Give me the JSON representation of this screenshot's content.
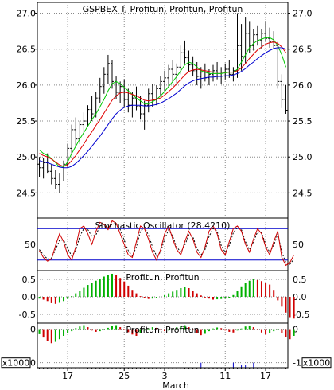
{
  "chart_data": [
    {
      "type": "candlestick",
      "title": "GSPBEX_I, Profitun, Profitun, Profitun",
      "y_ticks": [
        "27.0",
        "26.5",
        "26.0",
        "25.5",
        "25.0",
        "24.5"
      ],
      "ylim": [
        24.15,
        27.15
      ],
      "ohlc": [
        [
          24.9,
          25.0,
          24.72,
          24.85
        ],
        [
          24.85,
          24.98,
          24.7,
          24.92
        ],
        [
          24.92,
          25.05,
          24.78,
          24.8
        ],
        [
          24.8,
          24.9,
          24.62,
          24.7
        ],
        [
          24.7,
          24.82,
          24.55,
          24.62
        ],
        [
          24.62,
          24.78,
          24.5,
          24.72
        ],
        [
          24.72,
          24.95,
          24.66,
          24.9
        ],
        [
          24.9,
          25.18,
          24.85,
          25.12
        ],
        [
          25.12,
          25.45,
          25.05,
          25.38
        ],
        [
          25.38,
          25.55,
          25.15,
          25.25
        ],
        [
          25.25,
          25.5,
          25.18,
          25.45
        ],
        [
          25.45,
          25.62,
          25.3,
          25.5
        ],
        [
          25.5,
          25.72,
          25.42,
          25.66
        ],
        [
          25.66,
          25.85,
          25.5,
          25.6
        ],
        [
          25.6,
          25.9,
          25.55,
          25.82
        ],
        [
          25.82,
          26.1,
          25.75,
          25.98
        ],
        [
          25.98,
          26.25,
          25.88,
          26.15
        ],
        [
          26.15,
          26.42,
          26.02,
          26.3
        ],
        [
          26.3,
          26.35,
          25.95,
          26.05
        ],
        [
          26.05,
          26.12,
          25.8,
          25.9
        ],
        [
          25.9,
          26.05,
          25.75,
          25.98
        ],
        [
          25.98,
          26.08,
          25.7,
          25.8
        ],
        [
          25.8,
          25.95,
          25.62,
          25.72
        ],
        [
          25.72,
          25.9,
          25.55,
          25.82
        ],
        [
          25.82,
          25.98,
          25.65,
          25.7
        ],
        [
          25.7,
          25.85,
          25.52,
          25.6
        ],
        [
          25.6,
          25.78,
          25.38,
          25.72
        ],
        [
          25.72,
          25.95,
          25.62,
          25.88
        ],
        [
          25.88,
          26.02,
          25.7,
          25.8
        ],
        [
          25.8,
          26.0,
          25.72,
          25.95
        ],
        [
          25.95,
          26.12,
          25.85,
          26.05
        ],
        [
          26.05,
          26.2,
          25.92,
          26.1
        ],
        [
          26.1,
          26.28,
          25.98,
          26.22
        ],
        [
          26.22,
          26.35,
          26.05,
          26.15
        ],
        [
          26.15,
          26.3,
          26.02,
          26.25
        ],
        [
          26.25,
          26.55,
          26.15,
          26.45
        ],
        [
          26.45,
          26.62,
          26.3,
          26.38
        ],
        [
          26.38,
          26.48,
          26.18,
          26.28
        ],
        [
          26.28,
          26.4,
          26.12,
          26.2
        ],
        [
          26.2,
          26.32,
          26.0,
          26.12
        ],
        [
          26.12,
          26.25,
          25.95,
          26.18
        ],
        [
          26.18,
          26.3,
          26.05,
          26.1
        ],
        [
          26.1,
          26.22,
          26.0,
          26.15
        ],
        [
          26.15,
          26.28,
          26.05,
          26.2
        ],
        [
          26.2,
          26.32,
          26.08,
          26.12
        ],
        [
          26.12,
          26.25,
          26.02,
          26.18
        ],
        [
          26.18,
          26.3,
          26.08,
          26.22
        ],
        [
          26.22,
          26.35,
          26.1,
          26.15
        ],
        [
          26.15,
          26.25,
          26.05,
          26.2
        ],
        [
          26.2,
          27.0,
          26.1,
          26.55
        ],
        [
          26.55,
          26.85,
          26.2,
          26.4
        ],
        [
          26.4,
          26.95,
          26.3,
          26.72
        ],
        [
          26.72,
          26.88,
          26.45,
          26.55
        ],
        [
          26.55,
          26.78,
          26.48,
          26.7
        ],
        [
          26.7,
          26.82,
          26.55,
          26.62
        ],
        [
          26.62,
          26.78,
          26.5,
          26.72
        ],
        [
          26.72,
          26.88,
          26.6,
          26.65
        ],
        [
          26.65,
          26.8,
          26.52,
          26.6
        ],
        [
          26.6,
          26.75,
          26.5,
          26.55
        ],
        [
          26.55,
          26.6,
          25.95,
          26.05
        ],
        [
          26.05,
          26.15,
          25.68,
          25.8
        ],
        [
          25.8,
          26.0,
          25.6,
          25.65
        ]
      ],
      "moving_averages": [
        {
          "color": "#00c800",
          "values": [
            25.1,
            25.05,
            25.02,
            24.98,
            24.92,
            24.86,
            24.86,
            24.93,
            25.05,
            25.15,
            25.25,
            25.34,
            25.43,
            25.52,
            25.6,
            25.7,
            25.8,
            25.92,
            26.02,
            26.05,
            26.02,
            25.97,
            25.92,
            25.87,
            25.82,
            25.78,
            25.74,
            25.74,
            25.77,
            25.8,
            25.85,
            25.91,
            25.98,
            26.05,
            26.12,
            26.2,
            26.28,
            26.32,
            26.3,
            26.25,
            26.2,
            26.18,
            26.16,
            26.16,
            26.16,
            26.16,
            26.17,
            26.18,
            26.18,
            26.22,
            26.32,
            26.42,
            26.52,
            26.58,
            26.62,
            26.64,
            26.66,
            26.66,
            26.63,
            26.55,
            26.42,
            26.25
          ]
        },
        {
          "color": "#e00000",
          "values": [
            25.05,
            25.02,
            25.0,
            24.97,
            24.93,
            24.89,
            24.87,
            24.89,
            24.95,
            25.02,
            25.1,
            25.18,
            25.27,
            25.35,
            25.44,
            25.52,
            25.61,
            25.7,
            25.79,
            25.85,
            25.89,
            25.9,
            25.89,
            25.87,
            25.85,
            25.82,
            25.79,
            25.78,
            25.79,
            25.8,
            25.82,
            25.86,
            25.91,
            25.96,
            26.02,
            26.08,
            26.14,
            26.19,
            26.21,
            26.22,
            26.21,
            26.2,
            26.19,
            26.18,
            26.18,
            26.18,
            26.18,
            26.18,
            26.18,
            26.2,
            26.24,
            26.3,
            26.37,
            26.43,
            26.49,
            26.53,
            26.57,
            26.59,
            26.6,
            26.58,
            26.53,
            26.45
          ]
        },
        {
          "color": "#0000d0",
          "values": [
            24.95,
            24.93,
            24.92,
            24.9,
            24.88,
            24.86,
            24.85,
            24.85,
            24.87,
            24.91,
            24.96,
            25.02,
            25.08,
            25.15,
            25.22,
            25.29,
            25.37,
            25.45,
            25.53,
            25.6,
            25.65,
            25.69,
            25.71,
            25.72,
            25.72,
            25.72,
            25.71,
            25.71,
            25.72,
            25.73,
            25.75,
            25.78,
            25.81,
            25.85,
            25.89,
            25.94,
            25.99,
            26.03,
            26.06,
            26.08,
            26.09,
            26.1,
            26.11,
            26.11,
            26.12,
            26.12,
            26.13,
            26.13,
            26.14,
            26.16,
            26.19,
            26.23,
            26.28,
            26.32,
            26.37,
            26.41,
            26.45,
            26.48,
            26.51,
            26.52,
            26.52,
            26.5
          ]
        }
      ]
    },
    {
      "type": "line",
      "title": "Stochastic Oscillator (28.4210)",
      "y_ticks": [
        "50"
      ],
      "ylim": [
        0,
        100
      ],
      "levels": [
        80,
        20
      ],
      "k_values": [
        38,
        25,
        18,
        22,
        48,
        70,
        55,
        30,
        20,
        45,
        80,
        85,
        70,
        50,
        75,
        92,
        88,
        78,
        95,
        90,
        70,
        50,
        30,
        25,
        55,
        85,
        80,
        60,
        35,
        20,
        40,
        70,
        85,
        60,
        40,
        30,
        55,
        75,
        60,
        35,
        25,
        45,
        75,
        85,
        70,
        40,
        30,
        55,
        80,
        85,
        75,
        50,
        35,
        60,
        80,
        70,
        45,
        30,
        55,
        75,
        25,
        10,
        15,
        30
      ],
      "d_values": [
        40,
        30,
        22,
        24,
        40,
        58,
        58,
        42,
        28,
        38,
        65,
        80,
        78,
        65,
        68,
        85,
        88,
        82,
        88,
        90,
        78,
        58,
        38,
        28,
        45,
        75,
        82,
        68,
        45,
        28,
        35,
        60,
        78,
        65,
        45,
        35,
        48,
        68,
        64,
        42,
        30,
        40,
        65,
        80,
        75,
        48,
        35,
        48,
        72,
        82,
        78,
        55,
        40,
        55,
        74,
        72,
        50,
        35,
        48,
        70,
        35,
        15,
        12,
        22
      ]
    },
    {
      "type": "bar",
      "title": "Profitun, Profitun",
      "y_ticks": [
        "0.5",
        "0.0",
        "-0.5"
      ],
      "ylim": [
        -0.75,
        0.75
      ],
      "values": [
        -0.05,
        -0.08,
        -0.12,
        -0.18,
        -0.2,
        -0.17,
        -0.12,
        -0.06,
        0.02,
        0.1,
        0.18,
        0.26,
        0.34,
        0.4,
        0.46,
        0.52,
        0.58,
        0.62,
        0.66,
        0.62,
        0.54,
        0.44,
        0.32,
        0.2,
        0.1,
        0.02,
        -0.04,
        -0.06,
        -0.05,
        -0.03,
        0.0,
        0.05,
        0.1,
        0.15,
        0.2,
        0.25,
        0.28,
        0.25,
        0.18,
        0.1,
        0.04,
        -0.02,
        -0.05,
        -0.08,
        -0.07,
        -0.06,
        -0.05,
        -0.04,
        0.05,
        0.18,
        0.3,
        0.4,
        0.46,
        0.5,
        0.48,
        0.45,
        0.4,
        0.35,
        0.2,
        -0.1,
        -0.28,
        -0.45,
        -0.58,
        -0.62
      ]
    },
    {
      "type": "bar",
      "title": "Profitun, Profitun",
      "y_ticks": [
        "0",
        "-1000"
      ],
      "y_multiplier_label": "x1000",
      "ylim": [
        -1150,
        180
      ],
      "values": [
        -150,
        -250,
        -350,
        -420,
        -380,
        -300,
        -200,
        -120,
        -60,
        30,
        80,
        120,
        60,
        -40,
        -80,
        -60,
        -20,
        40,
        90,
        120,
        60,
        -20,
        -90,
        -160,
        -200,
        -120,
        -40,
        20,
        60,
        40,
        -20,
        -60,
        -40,
        20,
        60,
        100,
        120,
        60,
        -30,
        -120,
        -180,
        -140,
        -60,
        20,
        50,
        30,
        -40,
        -80,
        -100,
        -40,
        20,
        80,
        110,
        60,
        -20,
        -100,
        -160,
        -120,
        -60,
        -20,
        -120,
        -240,
        -300,
        -200
      ],
      "volume_bars": [
        [
          40,
          -1000
        ],
        [
          48,
          -1000
        ],
        [
          50,
          -1080
        ],
        [
          51,
          -1080
        ],
        [
          53,
          -1000
        ]
      ]
    }
  ],
  "x_axis": {
    "ticks": [
      {
        "index": 7,
        "label": "17"
      },
      {
        "index": 21,
        "label": "25"
      },
      {
        "index": 31,
        "label": "3"
      },
      {
        "index": 46,
        "label": "11"
      },
      {
        "index": 56,
        "label": "17"
      }
    ],
    "month_label": "March"
  }
}
